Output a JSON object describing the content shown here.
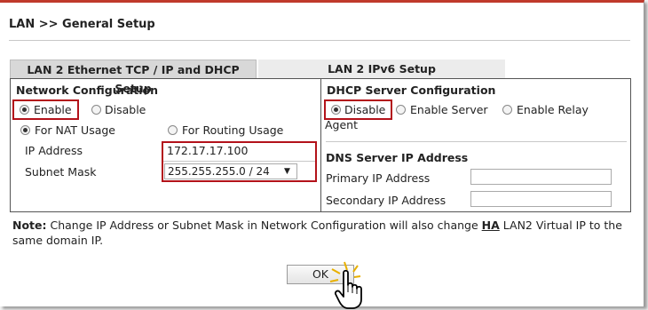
{
  "header": {
    "title": "LAN >> General Setup"
  },
  "tabs": [
    {
      "label": "LAN 2 Ethernet TCP / IP and DHCP Setup",
      "active": true
    },
    {
      "label": "LAN 2 IPv6 Setup",
      "active": false
    }
  ],
  "network": {
    "section_title": "Network Configuration",
    "enable_label": "Enable",
    "disable_label": "Disable",
    "selected": "Enable",
    "nat_label": "For NAT Usage",
    "routing_label": "For Routing Usage",
    "usage_selected": "For NAT Usage",
    "ip_label": "IP Address",
    "ip_value": "172.17.17.100",
    "mask_label": "Subnet Mask",
    "mask_value": "255.255.255.0 / 24"
  },
  "dhcp": {
    "section_title": "DHCP Server Configuration",
    "disable_label": "Disable",
    "server_label": "Enable Server",
    "relay_label": "Enable Relay",
    "relay_label_cont": "Agent",
    "selected": "Disable"
  },
  "dns": {
    "section_title": "DNS Server IP Address",
    "primary_label": "Primary IP Address",
    "primary_value": "",
    "secondary_label": "Secondary IP Address",
    "secondary_value": ""
  },
  "note": {
    "label": "Note:",
    "text_before": "Change IP Address or Subnet Mask in Network Configuration will also change",
    "link": "HA",
    "text_after": "LAN2 Virtual IP to the same domain IP."
  },
  "ok_label": "OK",
  "colors": {
    "highlight": "#b3121a",
    "top_border": "#c0392b"
  },
  "icons": {
    "cursor": "hand-pointer-icon"
  }
}
